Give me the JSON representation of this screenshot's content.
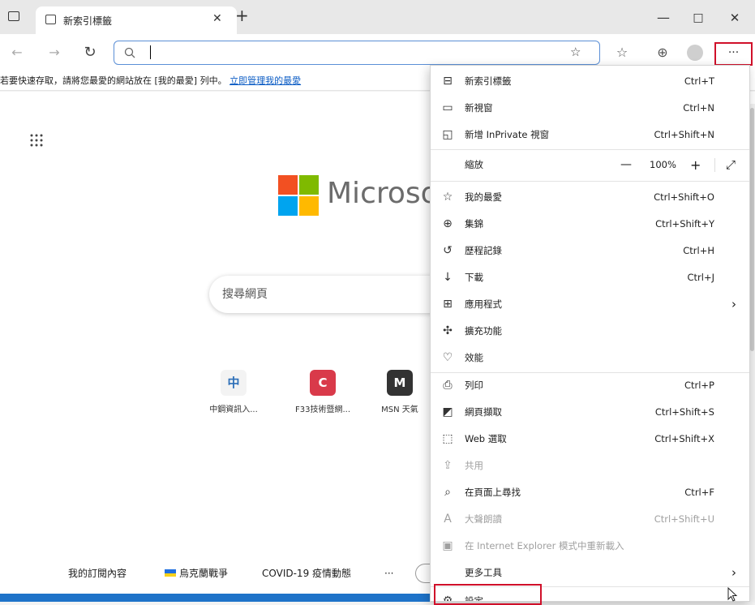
{
  "window": {
    "tab_title": "新索引標籤",
    "new_tab_symbol": "+",
    "minimize_symbol": "—",
    "maximize_symbol": "□",
    "close_symbol": "✕"
  },
  "address_bar": {
    "value": "",
    "placeholder": ""
  },
  "favorites_bar": {
    "prompt": "若要快速存取，請將您最愛的網站放在 [我的最愛] 列中。",
    "link": "立即管理我的最愛"
  },
  "new_tab_page": {
    "logo_text": "Microso",
    "search_placeholder": "搜尋網頁",
    "quick_links": [
      {
        "label": "中鋼資訊入...",
        "icon_char": "中",
        "color": "#2d6fb8"
      },
      {
        "label": "F33技術暨網...",
        "icon_char": "C",
        "color": "#d93a4a"
      },
      {
        "label": "MSN 天氣",
        "icon_char": "M",
        "color": "#333333"
      }
    ],
    "feed_bar": {
      "my_feed": "我的訂閱內容",
      "topic_1": "烏克蘭戰爭",
      "topic_2": "COVID-19 疫情動態",
      "more": "···"
    }
  },
  "menu": {
    "new_tab": {
      "label": "新索引標籤",
      "shortcut": "Ctrl+T"
    },
    "new_window": {
      "label": "新視窗",
      "shortcut": "Ctrl+N"
    },
    "new_inprivate": {
      "label": "新增 InPrivate 視窗",
      "shortcut": "Ctrl+Shift+N"
    },
    "zoom": {
      "label": "縮放",
      "minus": "—",
      "value": "100%",
      "plus": "+",
      "fullscreen": "⤢"
    },
    "favorites": {
      "label": "我的最愛",
      "shortcut": "Ctrl+Shift+O"
    },
    "collections": {
      "label": "集錦",
      "shortcut": "Ctrl+Shift+Y"
    },
    "history": {
      "label": "歷程記錄",
      "shortcut": "Ctrl+H"
    },
    "downloads": {
      "label": "下載",
      "shortcut": "Ctrl+J"
    },
    "apps": {
      "label": "應用程式",
      "arrow": "›"
    },
    "extensions": {
      "label": "擴充功能"
    },
    "performance": {
      "label": "效能"
    },
    "print": {
      "label": "列印",
      "shortcut": "Ctrl+P"
    },
    "web_capture": {
      "label": "網頁擷取",
      "shortcut": "Ctrl+Shift+S"
    },
    "web_select": {
      "label": "Web 選取",
      "shortcut": "Ctrl+Shift+X"
    },
    "share": {
      "label": "共用"
    },
    "find": {
      "label": "在頁面上尋找",
      "shortcut": "Ctrl+F"
    },
    "read_aloud": {
      "label": "大聲朗讀",
      "shortcut": "Ctrl+Shift+U"
    },
    "ie_mode": {
      "label": "在 Internet Explorer 模式中重新載入"
    },
    "more_tools": {
      "label": "更多工具",
      "arrow": "›"
    },
    "settings": {
      "label": "設定"
    }
  },
  "colors": {
    "highlight_red": "#d0102a",
    "accent_blue": "#1e73c9",
    "link_blue": "#0a5bc4"
  }
}
